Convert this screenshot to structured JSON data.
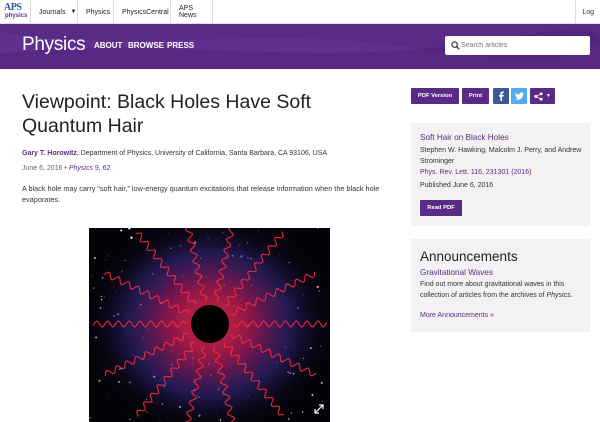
{
  "topbar": {
    "logo_line1": "APS",
    "logo_line2": "physics",
    "menu": [
      {
        "label": "Journals",
        "caret": "▼"
      },
      {
        "label": "Physics"
      },
      {
        "label": "PhysicsCentral"
      },
      {
        "label": "APS News"
      }
    ],
    "login_label": "Log"
  },
  "header": {
    "brand": "Physics",
    "nav": [
      "ABOUT",
      "BROWSE",
      "PRESS"
    ],
    "search_placeholder": "Search articles",
    "background_color": "#5a2a87"
  },
  "article": {
    "title": "Viewpoint: Black Holes Have Soft Quantum Hair",
    "author_name": "Gary T. Horowitz",
    "author_affiliation": ", Department of Physics, University of California, Santa Barbara, CA 93106, USA",
    "date": "June 6, 2016",
    "bullet": " • ",
    "journal": "Physics",
    "volume": " 9, 62",
    "summary": "A black hole may carry “soft hair,” low-energy quantum excitations that release information when the black hole evaporates."
  },
  "actions": {
    "pdf_label": "PDF Version",
    "print_label": "Print",
    "facebook_icon": "facebook-icon",
    "twitter_icon": "twitter-icon",
    "share_icon": "share-icon",
    "share_caret": "▼"
  },
  "related": {
    "title": "Soft Hair on Black Holes",
    "authors": "Stephen W. Hawking, Malcolm J. Perry, and Andrew Strominger",
    "citation": "Phys. Rev. Lett. 116, 231301 (2016)",
    "published": "Published June 6, 2016",
    "read_pdf_label": "Read PDF"
  },
  "announcements": {
    "heading": "Announcements",
    "item_title": "Gravitational Waves",
    "item_text_before": "Find out more about gravitational waves in this collection of articles from the archives of ",
    "item_text_em": "Physics",
    "item_text_after": ".",
    "more_link": "More Announcements »"
  },
  "colors": {
    "brand_purple": "#5a2a87",
    "card_background": "#f2f2f2",
    "facebook": "#3b5998",
    "twitter": "#55acee"
  }
}
